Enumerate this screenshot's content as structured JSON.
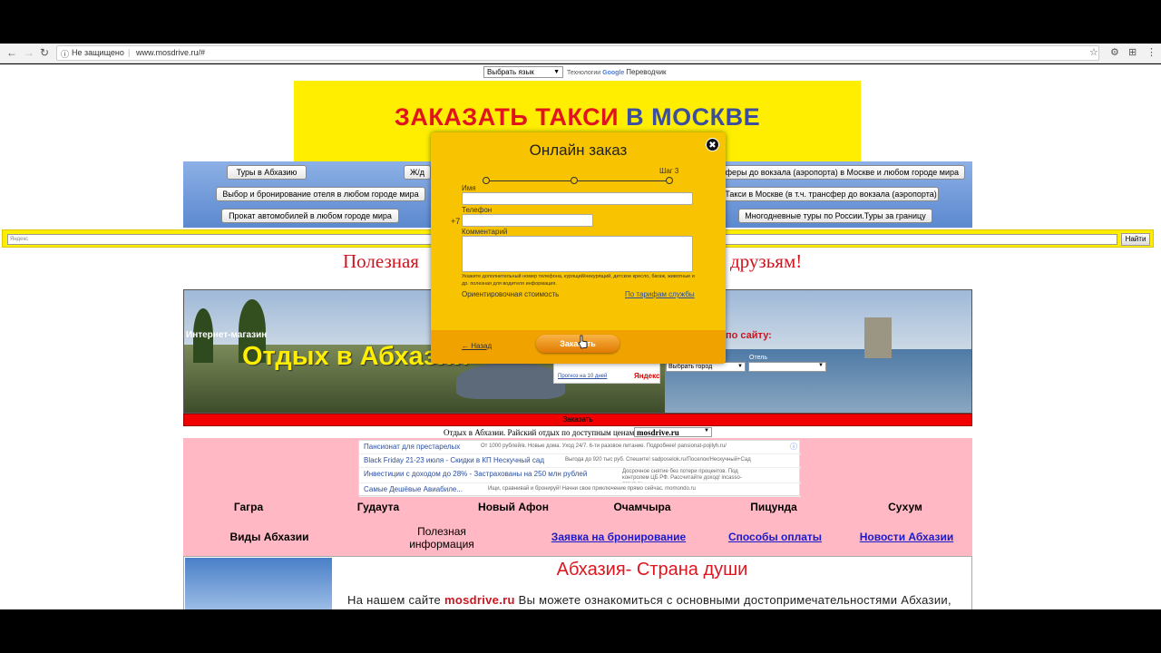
{
  "browser": {
    "security_label": "Не защищено",
    "url": "www.mosdrive.ru/#"
  },
  "translate": {
    "select_value": "Выбрать язык",
    "powered_prefix": "Технологии",
    "google": "Google",
    "translator": "Переводчик"
  },
  "header": {
    "title_part1": "ЗАКАЗАТЬ ТАКСИ",
    "title_part2": "В МОСКВЕ",
    "title_color1": "#e0141e",
    "title_color2": "#3b4f9e"
  },
  "menu_buttons": [
    "Туры в Абхазию",
    "Ж/д",
    "сферы до вокзала (аэропорта) в Москве и любом городе мира",
    "Выбор и бронирование отеля в любом городе мира",
    "Такси в Москве (в т.ч. трансфер до вокзала (аэропорта)",
    "Прокат автомобилей в любом городе мира",
    "Многодневные туры по России.Туры за границу"
  ],
  "search": {
    "placeholder": "Яндекс",
    "button": "Найти"
  },
  "slogan": {
    "left": "Полезная",
    "right": "друзьям!"
  },
  "banner": {
    "shop_label": "Интернет-магазин",
    "big_title": "Отдых в Абхазии",
    "weather_link": "Прогноз на 10 дней",
    "yandex": "Яндекс",
    "site_search": "по сайту:",
    "hotel_label": "Отель",
    "city_select": "Выбрать город",
    "hotel_select": ""
  },
  "order_bar": "Заказать",
  "site_line": {
    "text": "Отдых в Абхазии. Райский отдых по доступным ценам!",
    "select": "mosdrive.ru"
  },
  "ads": [
    {
      "title": "Пансионат для престарелых",
      "desc": "От 1000 рублей/в. Новые дома. Уход 24/7. 6-ти разовое питание. Подробнее! pansionat-pojilyh.ru/"
    },
    {
      "title": "Black Friday 21-23 июля - Скидки в КП Нескучный сад",
      "desc": "Выгода до 920 тыс руб. Спешите! sadposelok.ru/Поселок/Нескучный+Сад"
    },
    {
      "title": "Инвестиции с доходом до 28% - Застрахованы на 250 млн рублей",
      "desc": "Досрочное снятие без потери процентов. Под контролем ЦБ РФ. Рассчитайте доход! incasso-group.ru"
    },
    {
      "title": "Самые Дешёвые Авиабиле...",
      "desc": "Ищи, сравнивай и бронируй! Начни свое приключение прямо сейчас. momondo.ru"
    }
  ],
  "towns": [
    "Гагра",
    "Гудаута",
    "Новый Афон",
    "Очамчыра",
    "Пицунда",
    "Сухум"
  ],
  "nav2": {
    "views": "Виды Абхазии",
    "useful": "Полезная информация",
    "booking": "Заявка на бронирование",
    "payment": "Способы оплаты",
    "news": "Новости Абхазии"
  },
  "content": {
    "title": "Абхазия- Страна души",
    "text_prefix": "На нашем сайте",
    "text_site": "mosdrive.ru",
    "text_suffix": "Вы можете ознакомиться с основными достопримечательностями Абхазии,"
  },
  "modal": {
    "title": "Онлайн заказ",
    "step": "Шаг 3",
    "name_label": "Имя",
    "phone_label": "Телефон",
    "phone_prefix": "+7",
    "comment_label": "Комментарий",
    "hint": "Укажите дополнительный номер телефона, курящий/некурящий, детское кресло, багаж, животные и др. полезная для водителя информация.",
    "cost_label": "Ориентировочная стоимость",
    "tariff_link": "По тарифам службы",
    "back": "← Назад",
    "submit": "Заказать"
  }
}
